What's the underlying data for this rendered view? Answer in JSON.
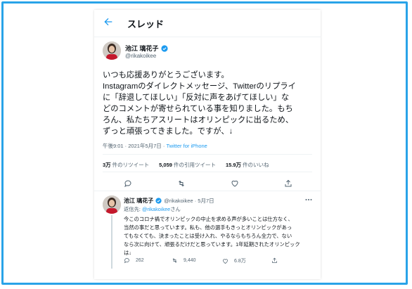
{
  "header": {
    "title": "スレッド"
  },
  "tweet": {
    "name": "池江 璃花子",
    "handle": "@rikakoikee",
    "lines": [
      "いつも応援ありがとうございます。",
      "Instagramのダイレクトメッセージ、Twitterのリプライ",
      "に「辞退してほしい」「反対に声をあげてほしい」な",
      "どのコメントが寄せられている事を知りました。もち",
      "ろん、私たちアスリートはオリンピックに出るため、",
      "ずっと頑張ってきました。ですが、↓"
    ],
    "timestamp": "午後9:01 · 2021年5月7日 · ",
    "source": "Twitter for iPhone",
    "stats": [
      {
        "value": "3万",
        "label": "件のリツイート"
      },
      {
        "value": "5,059",
        "label": "件の引用ツイート"
      },
      {
        "value": "15.9万",
        "label": "件のいいね"
      }
    ]
  },
  "reply": {
    "name": "池江 璃花子",
    "handle_date": "@rikakoikee · 5月7日",
    "replying_prefix": "返信先: ",
    "replying_handle": "@rikakoikee",
    "replying_suffix": "さん",
    "lines": [
      "今このコロナ禍でオリンピックの中止を求める声が多いことは仕方なく、",
      "当然の事だと思っています。私も、他の選手もきっとオリンピックがあっ",
      "てもなくても、決まったことは受け入れ、やるならもちろん全力で、ない",
      "なら次に向けて、頑張るだけだと思っています。1年延期されたオリンピック",
      "は↓"
    ],
    "counts": {
      "replies": "262",
      "retweets": "9,440",
      "likes": "6.8万"
    }
  },
  "colors": {
    "accent": "#1d9bf0",
    "frame": "#29a3e8"
  }
}
